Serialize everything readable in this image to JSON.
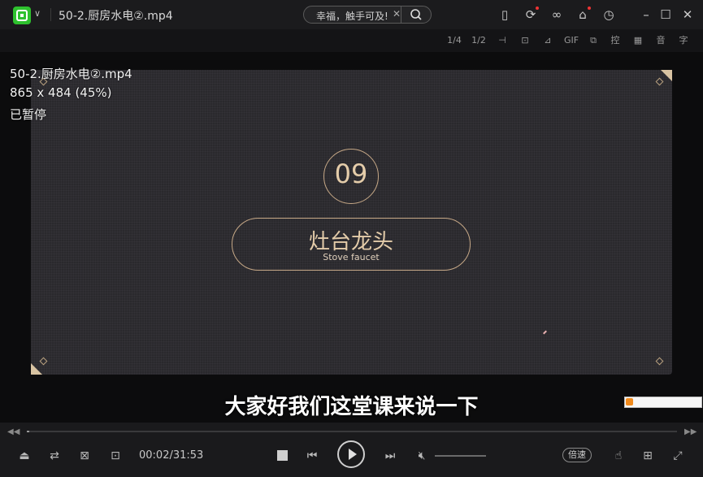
{
  "window": {
    "title": "50-2.厨房水电②.mp4"
  },
  "search": {
    "text": "幸福，触手可及!"
  },
  "toolbar2": {
    "items": [
      "1/4",
      "1/2",
      "剪",
      "截",
      "裁",
      "GIF",
      "复",
      "控",
      "画",
      "音",
      "字"
    ]
  },
  "info": {
    "filename": "50-2.厨房水电②.mp4",
    "resolution": "865 x 484 (45%)",
    "status": "已暂停"
  },
  "slide": {
    "number": "09",
    "title_cn": "灶台龙头",
    "title_en": "Stove faucet"
  },
  "subtitle": "大家好我们这堂课来说一下",
  "playback": {
    "time": "00:02/31:53",
    "progress": 0.001,
    "speed_label": "倍速"
  },
  "colors": {
    "brand": "#2ec12e",
    "accent": "#c7a987"
  }
}
